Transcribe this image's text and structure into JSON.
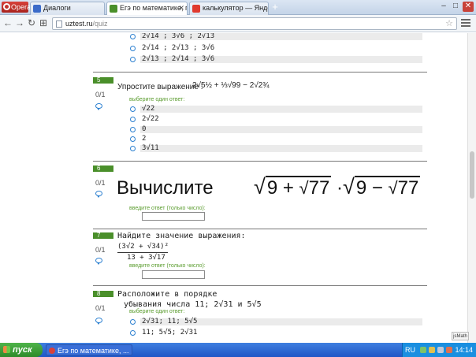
{
  "browser": {
    "opera_label": "Opera",
    "tabs": [
      {
        "label": "Диалоги"
      },
      {
        "label": "Егэ по математике, подгот"
      },
      {
        "label": "калькулятор — Яндекс: на"
      }
    ],
    "url_host": "uztest.ru",
    "url_path": "/quiz",
    "colors": {
      "accent_green": "#4a8f2a",
      "hint_green": "#5a9c2e",
      "radio_blue": "#2a7fd0"
    }
  },
  "quiz": {
    "prev_options": [
      "2√14 ;  3√6 ;  2√13",
      "2√14 ;  2√13 ;  3√6",
      "2√13 ;  2√14 ;  3√6"
    ],
    "q5": {
      "number": "5",
      "score": "0/1",
      "prompt": "Упростите выражение :",
      "expr": "2√5½ + ⅓√99 − 2√2¾",
      "hint": "выберите один ответ:",
      "options": [
        "√22",
        "2√22",
        "0",
        "2",
        "3√11"
      ]
    },
    "q6": {
      "number": "6",
      "score": "0/1",
      "prompt": "Вычислите",
      "expr_a": "9 + ",
      "expr_b": "77",
      "expr_c": "9 − ",
      "expr_d": "77",
      "hint": "введите ответ (только число):"
    },
    "q7": {
      "number": "7",
      "score": "0/1",
      "prompt": "Найдите значение выражения:",
      "numerator": "(3√2 + √34)²",
      "denominator": "13 + 3√17",
      "hint": "введите ответ (только число):"
    },
    "q8": {
      "number": "8",
      "score": "0/1",
      "prompt_line1": "Расположите в порядке",
      "prompt_line2": "убывания числа 11; 2√31 и 5√5",
      "hint": "выберите один ответ:",
      "options": [
        "2√31;  11;  5√5",
        "11;  5√5;  2√31"
      ]
    }
  },
  "jsmath_badge": "jsMath",
  "taskbar": {
    "start_label": "пуск",
    "item": "Егэ по математике, ...",
    "lang": "RU",
    "time": "14:14"
  }
}
